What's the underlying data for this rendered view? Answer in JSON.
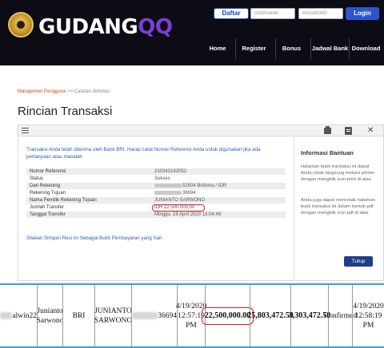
{
  "header": {
    "logo_text_main": "GUDANG",
    "logo_text_accent": "QQ",
    "register_label": "Daftar",
    "username_placeholder": "USERNAME",
    "password_placeholder": "PASSWORD",
    "login_label": "Login",
    "nav": [
      "Home",
      "Register",
      "Bonus",
      "Jadwal Bank",
      "Download"
    ]
  },
  "breadcrumb": {
    "link": "Manajemen Pengguna",
    "separator": ">>",
    "current": "Catatan Aktivitas"
  },
  "page_title": "Rincian Transaksi",
  "notice": "Transaksi Anda telah diterima oleh Bank BRI. Harap catat Nomor Referensi Anda untuk digunakan jika ada pertanyaan atau masalah",
  "details": [
    {
      "label": "Nomor Referensi",
      "value": "210343182052"
    },
    {
      "label": "Status",
      "value": "Sukses"
    },
    {
      "label": "Dari Rekening",
      "value": "52504 BritAma / IDR"
    },
    {
      "label": "Rekening Tujuan",
      "value": "36694"
    },
    {
      "label": "Nama Pemilik Rekening Tujuan",
      "value": "JUNIANTO SARWONO"
    },
    {
      "label": "Jumlah Transfer",
      "value": "IDR 22.500.000,00"
    },
    {
      "label": "Tanggal Transfer",
      "value": "Minggu, 19 April 2020 13:04:49"
    }
  ],
  "print_link": "Silakan Simpan Resi ini Sebagai Bukti Pembayaran yang Sah",
  "help": {
    "title": "Informasi Bantuan",
    "p1": "Halaman bukti transaksi ini dapat Anda cetak langsung melalui printer dengan mengklik icon print di atas.",
    "p2": "Anda juga dapat mencetak halaman bukti transaksi ini dalam bentuk pdf dengan mengklik icon pdf di atas.",
    "close_label": "Tutup"
  },
  "strip": {
    "user": "alwin22",
    "sender_name_1": "Junianto",
    "sender_name_2": "Sarwono",
    "bank": "BRI",
    "receiver_1": "JUNIANTO",
    "receiver_2": "SARWONO",
    "account_suffix": "36694",
    "date1_line1": "4/19/2020",
    "date1_line2": "12:57:19",
    "date1_line3": "PM",
    "amount": "22,500,000.00",
    "balance_before": "25,803,472.50",
    "balance_after": "3,303,472.50",
    "status": "Confirmed",
    "date2_line1": "4/19/2020",
    "date2_line2": "12:58:19 PM"
  }
}
